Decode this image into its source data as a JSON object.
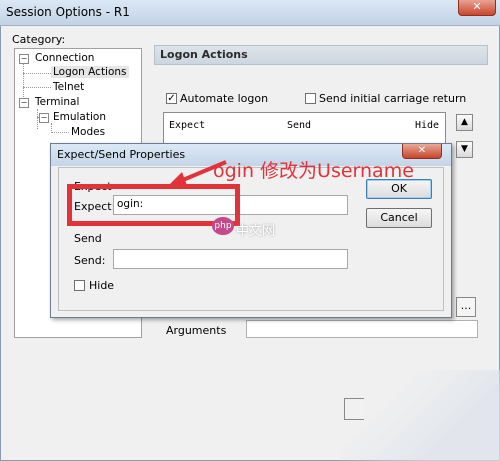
{
  "window": {
    "title": "Session Options - R1",
    "close_label": "✕"
  },
  "category_label": "Category:",
  "tree": [
    {
      "label": "Connection",
      "toggle": "−"
    },
    {
      "label": "Logon Actions",
      "toggle": ""
    },
    {
      "label": "Telnet",
      "toggle": ""
    },
    {
      "label": "Terminal",
      "toggle": "−"
    },
    {
      "label": "Emulation",
      "toggle": "−"
    },
    {
      "label": "Modes",
      "toggle": ""
    }
  ],
  "panel": {
    "title": "Logon Actions",
    "automate_logon": {
      "label": "Automate logon",
      "checked": true,
      "mark": "✓"
    },
    "send_cr": {
      "label": "Send initial carriage return",
      "checked": false,
      "mark": ""
    },
    "columns": [
      "Expect",
      "Send",
      "Hide"
    ],
    "arguments_label": "Arguments",
    "browse_label": "..."
  },
  "dialog": {
    "title": "Expect/Send Properties",
    "close_label": "✕",
    "expect_group": "Expect",
    "expect_label": "Expect:",
    "expect_value": "ogin:",
    "send_group": "Send",
    "send_label": "Send:",
    "send_value": "",
    "hide_label": "Hide",
    "ok_label": "OK",
    "cancel_label": "Cancel"
  },
  "annotation": {
    "text": "ogin 修改为Username",
    "color": "#e2323a"
  },
  "watermark": {
    "logo": "php",
    "text": "中文网"
  },
  "icons": {
    "up": "▲",
    "down": "▼"
  }
}
